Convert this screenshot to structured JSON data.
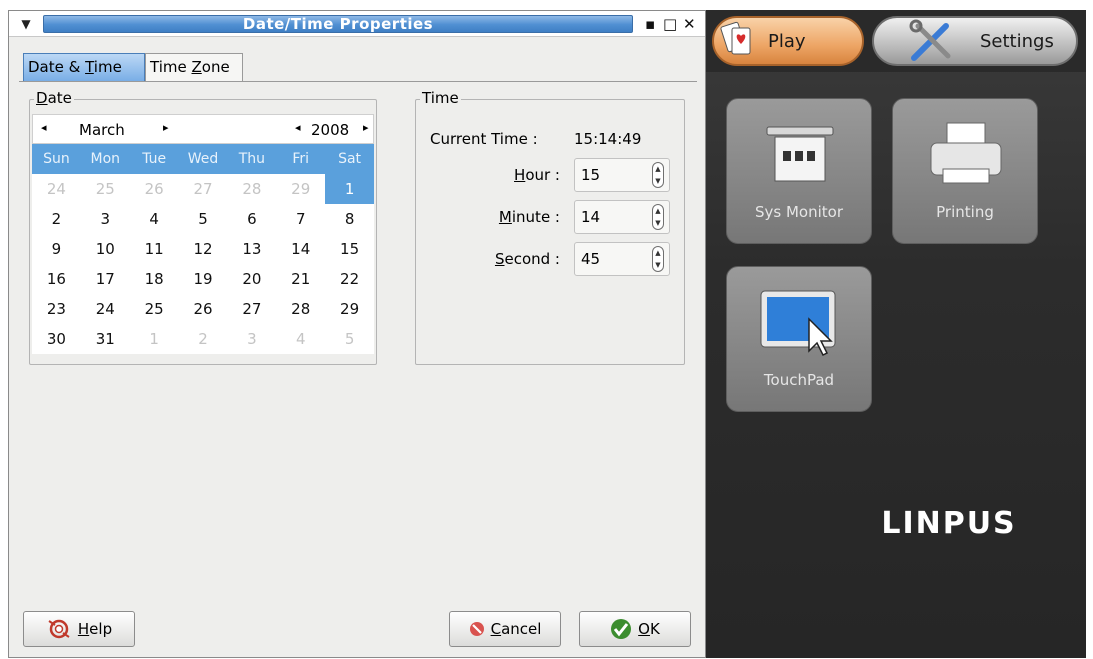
{
  "window": {
    "title": "Date/Time Properties",
    "menu_icon": "▼",
    "minimize_icon": "▪",
    "maximize_icon": "□",
    "close_icon": "✕"
  },
  "tabs": [
    {
      "label_pre": "Date & ",
      "mnemonic": "T",
      "label_post": "ime",
      "active": true
    },
    {
      "label_pre": "Time ",
      "mnemonic": "Z",
      "label_post": "one",
      "active": false
    }
  ],
  "date_frame": {
    "legend_mnemonic": "D",
    "legend_rest": "ate",
    "month": "March",
    "year": "2008",
    "prev_arrow": "◂",
    "next_arrow": "▸",
    "weekdays": [
      "Sun",
      "Mon",
      "Tue",
      "Wed",
      "Thu",
      "Fri",
      "Sat"
    ],
    "weeks": [
      [
        "24",
        "25",
        "26",
        "27",
        "28",
        "29",
        "1"
      ],
      [
        "2",
        "3",
        "4",
        "5",
        "6",
        "7",
        "8"
      ],
      [
        "9",
        "10",
        "11",
        "12",
        "13",
        "14",
        "15"
      ],
      [
        "16",
        "17",
        "18",
        "19",
        "20",
        "21",
        "22"
      ],
      [
        "23",
        "24",
        "25",
        "26",
        "27",
        "28",
        "29"
      ],
      [
        "30",
        "31",
        "1",
        "2",
        "3",
        "4",
        "5"
      ]
    ],
    "selected_day": "1"
  },
  "time_frame": {
    "legend": "Time",
    "current_time_label": "Current Time :",
    "current_time_value": "15:14:49",
    "hour_mnemonic": "H",
    "hour_rest": "our :",
    "hour_value": "15",
    "minute_mnemonic": "M",
    "minute_rest": "inute :",
    "minute_value": "14",
    "second_mnemonic": "S",
    "second_rest": "econd :",
    "second_value": "45"
  },
  "buttons": {
    "help_mnemonic": "H",
    "help_rest": "elp",
    "cancel_mnemonic": "C",
    "cancel_rest": "ancel",
    "ok_mnemonic": "O",
    "ok_rest": "K"
  },
  "desktop": {
    "play_label": "Play",
    "settings_label": "Settings",
    "tiles": [
      {
        "label": "Sys Monitor"
      },
      {
        "label": "Printing"
      },
      {
        "label": "TouchPad"
      }
    ],
    "brand": "LINPUS"
  },
  "colors": {
    "title_blue": "#4f8fd2",
    "calendar_header": "#5aa0dc",
    "play_orange": "#eda565",
    "desktop_bg": "#2c2c2c"
  }
}
